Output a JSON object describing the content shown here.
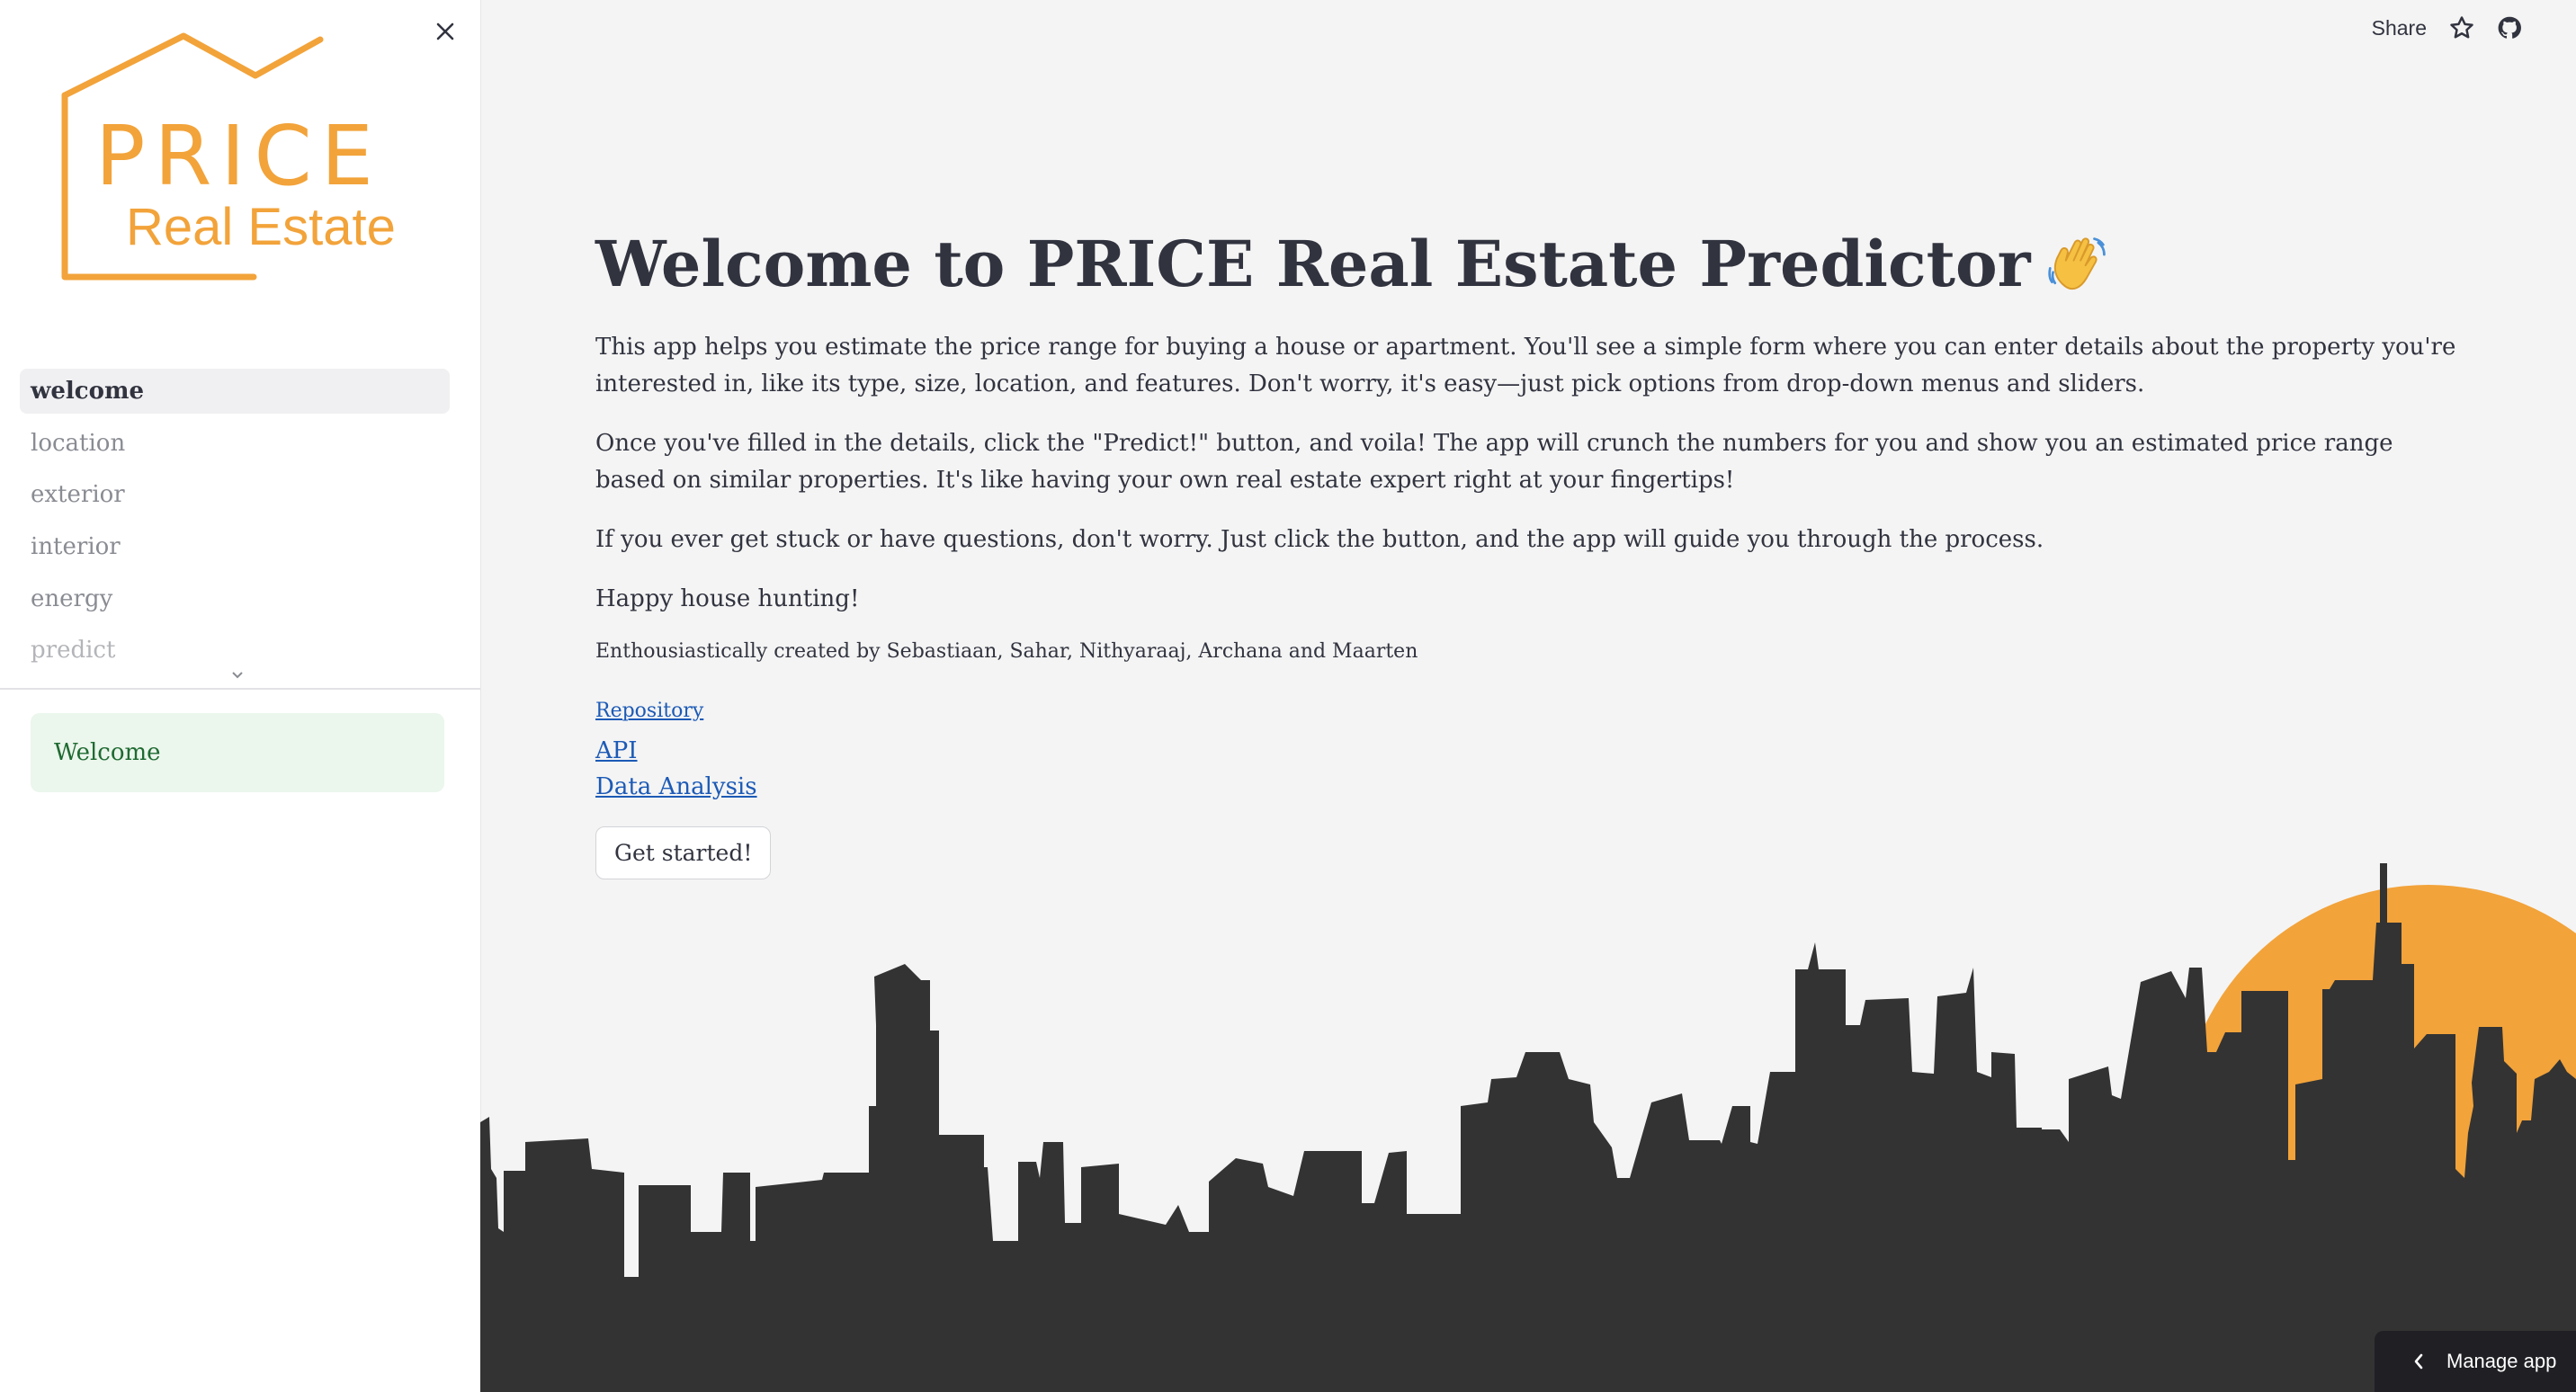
{
  "sidebar": {
    "logo": {
      "line1": "PRICE",
      "line2": "Real Estate"
    },
    "nav_items": [
      {
        "label": "welcome"
      },
      {
        "label": "location"
      },
      {
        "label": "exterior"
      },
      {
        "label": "interior"
      },
      {
        "label": "energy"
      },
      {
        "label": "predict"
      }
    ],
    "alert_text": "Welcome"
  },
  "header": {
    "share_label": "Share"
  },
  "main": {
    "title": "Welcome to PRICE Real Estate Predictor",
    "paragraphs": [
      "This app helps you estimate the price range for buying a house or apartment. You'll see a simple form where you can enter details about the property you're interested in, like its type, size, location, and features. Don't worry, it's easy—just pick options from drop-down menus and sliders.",
      "Once you've filled in the details, click the \"Predict!\" button, and voila! The app will crunch the numbers for you and show you an estimated price range based on similar properties. It's like having your own real estate expert right at your fingertips!",
      "If you ever get stuck or have questions, don't worry. Just click the button, and the app will guide you through the process.",
      "Happy house hunting!"
    ],
    "credits": "Enthousiastically created by Sebastiaan, Sahar, Nithyaraaj, Archana and Maarten",
    "links": {
      "repository": "Repository",
      "api": "API",
      "data_analysis": "Data Analysis"
    },
    "cta_label": "Get started!"
  },
  "footer": {
    "manage_label": "Manage app"
  },
  "colors": {
    "brand_orange": "#f2a33a",
    "skyline": "#333333",
    "link": "#1c5ab6",
    "alert_bg": "#ebf6ec"
  },
  "icons": [
    "close-icon",
    "star-icon",
    "github-icon",
    "chevron-down-icon",
    "chevron-left-icon",
    "waving-hand-icon"
  ]
}
